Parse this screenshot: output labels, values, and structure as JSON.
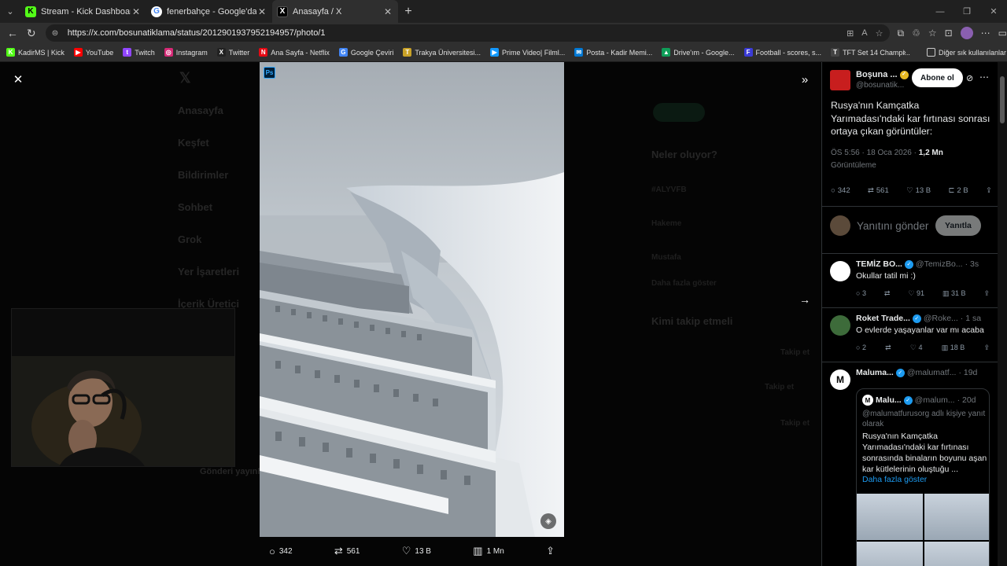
{
  "browser": {
    "tabs": [
      {
        "title": "Stream - Kick Dashboard",
        "favicon": "kick-icon",
        "color": "#53fc18",
        "glyph": "K"
      },
      {
        "title": "fenerbahçe - Google'da Ara",
        "favicon": "google-icon",
        "color": "#ffffff",
        "glyph": "G"
      },
      {
        "title": "Anasayfa / X",
        "favicon": "x-icon",
        "color": "#000000",
        "glyph": "X"
      }
    ],
    "url": "https://x.com/bosunatiklama/status/2012901937952194957/photo/1",
    "bookmarks": [
      {
        "label": "KadirMS | Kick",
        "color": "#53fc18",
        "glyph": "K"
      },
      {
        "label": "YouTube",
        "color": "#ff0000",
        "glyph": "▶"
      },
      {
        "label": "Twitch",
        "color": "#9146ff",
        "glyph": "t"
      },
      {
        "label": "Instagram",
        "color": "#d62976",
        "glyph": "◎"
      },
      {
        "label": "Twitter",
        "color": "#222222",
        "glyph": "X"
      },
      {
        "label": "Ana Sayfa - Netflix",
        "color": "#e50914",
        "glyph": "N"
      },
      {
        "label": "Google Çeviri",
        "color": "#4285f4",
        "glyph": "G"
      },
      {
        "label": "Trakya Üniversitesi...",
        "color": "#c9a227",
        "glyph": "T"
      },
      {
        "label": "Prime Video| Filml...",
        "color": "#1399ff",
        "glyph": "▶"
      },
      {
        "label": "Posta - Kadir Memi...",
        "color": "#0078d4",
        "glyph": "✉"
      },
      {
        "label": "Drive'ım - Google...",
        "color": "#0f9d58",
        "glyph": "▲"
      },
      {
        "label": "Football - scores, s...",
        "color": "#3b3bd6",
        "glyph": "F"
      },
      {
        "label": "TFT Set 14 Champi...",
        "color": "#444444",
        "glyph": "T"
      }
    ],
    "bookmarks_other": "Diğer sık kullanılanlar"
  },
  "background_nav": [
    {
      "label": "Anasayfa"
    },
    {
      "label": "Keşfet"
    },
    {
      "label": "Bildirimler"
    },
    {
      "label": "Sohbet"
    },
    {
      "label": "Grok"
    },
    {
      "label": "Yer İşaretleri"
    },
    {
      "label": "İçerik Üretici"
    }
  ],
  "background_right": {
    "trends_title": "Neler oluyor?",
    "trends": [
      "#ALYVFB",
      "Hakeme",
      "Mustafa",
      "Daha fazla göster"
    ],
    "follow_title": "Kimi takip etmeli",
    "follow_btns": [
      "Takip et",
      "Takip et",
      "Takip et"
    ],
    "post_btn": "Gönderi yayınla"
  },
  "photo_actions": {
    "replies": "342",
    "reposts": "561",
    "likes": "13 B",
    "views": "1 Mn"
  },
  "tweet": {
    "author_name": "Boşuna ...",
    "author_handle": "@bosunatik...",
    "follow_label": "Abone ol",
    "text": "Rusya'nın Kamçatka Yarımadası'ndaki kar fırtınası sonrası ortaya çıkan görüntüler:",
    "time": "ÖS 5:56 · 18 Oca 2026 · ",
    "views_count": "1,2 Mn",
    "views_label": "Görüntüleme",
    "stats": {
      "replies": "342",
      "reposts": "561",
      "likes": "13 B",
      "bookmarks": "2 B"
    },
    "reply_placeholder": "Yanıtını gönder",
    "reply_button": "Yanıtla"
  },
  "replies": [
    {
      "name": "TEMİZ BO...",
      "handle": "@TemizBo...",
      "time": "· 3s",
      "text": "Okullar tatil mi :)",
      "replies": "3",
      "reposts": "",
      "likes": "91",
      "views": "31 B",
      "avatar_color": "#ffffff",
      "badge_color": "#1d9bf0"
    },
    {
      "name": "Roket Trade...",
      "handle": "@Roke...",
      "time": "· 1 sa",
      "text": "O evlerde yaşayanlar var mı acaba",
      "replies": "2",
      "reposts": "",
      "likes": "4",
      "views": "18 B",
      "avatar_color": "#3d6b3a",
      "badge_color": "#1d9bf0"
    },
    {
      "name": "Maluma...",
      "handle": "@malumatf...",
      "time": "· 19d",
      "avatar_color": "#ffffff",
      "badge_color": "#1d9bf0",
      "quote": {
        "name": "Malu...",
        "handle": "@malum...",
        "time": "· 20d",
        "sub": "@malumatfurusorg adlı kişiye yanıt olarak",
        "text": "Rusya'nın Kamçatka Yarımadası'ndaki kar fırtınası sonrasında binaların boyunu aşan kar kütlelerinin oluştuğu ...",
        "more": "Daha fazla göster"
      }
    }
  ]
}
